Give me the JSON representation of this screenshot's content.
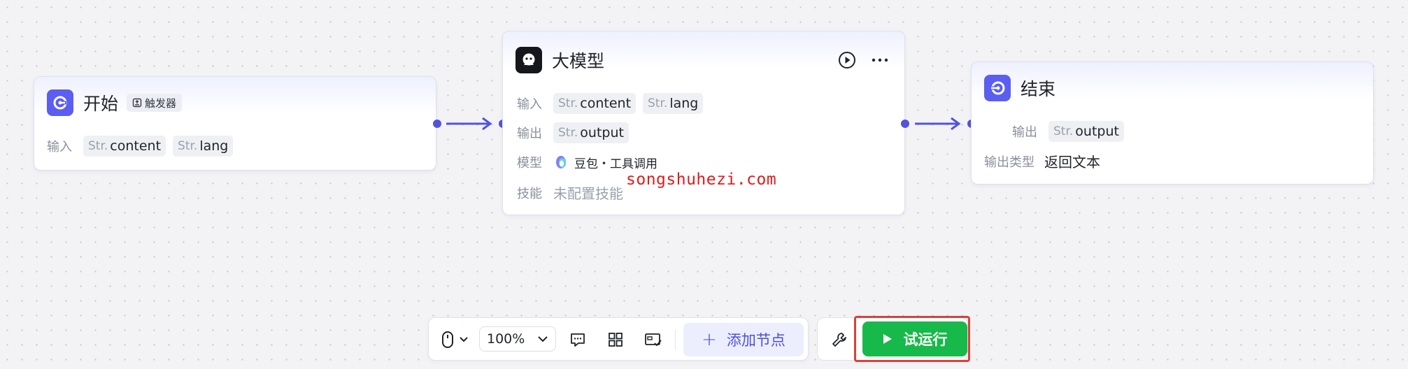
{
  "start_node": {
    "title": "开始",
    "tag": "触发器",
    "input_label": "输入",
    "inputs": [
      {
        "type": "Str.",
        "name": "content"
      },
      {
        "type": "Str.",
        "name": "lang"
      }
    ]
  },
  "llm_node": {
    "title": "大模型",
    "input_label": "输入",
    "inputs": [
      {
        "type": "Str.",
        "name": "content"
      },
      {
        "type": "Str.",
        "name": "lang"
      }
    ],
    "output_label": "输出",
    "outputs": [
      {
        "type": "Str.",
        "name": "output"
      }
    ],
    "model_label": "模型",
    "model_value": "豆包・工具调用",
    "skill_label": "技能",
    "skill_value": "未配置技能"
  },
  "end_node": {
    "title": "结束",
    "output_label": "输出",
    "outputs": [
      {
        "type": "Str.",
        "name": "output"
      }
    ],
    "output_type_label": "输出类型",
    "output_type_value": "返回文本"
  },
  "watermark": "songshuhezi.com",
  "toolbar": {
    "zoom": "100%",
    "add_node_label": "添加节点",
    "run_label": "试运行"
  },
  "colors": {
    "accent": "#5b5ef0",
    "edge": "#5254d9",
    "run": "#17b94a",
    "highlight": "#d9423a"
  }
}
